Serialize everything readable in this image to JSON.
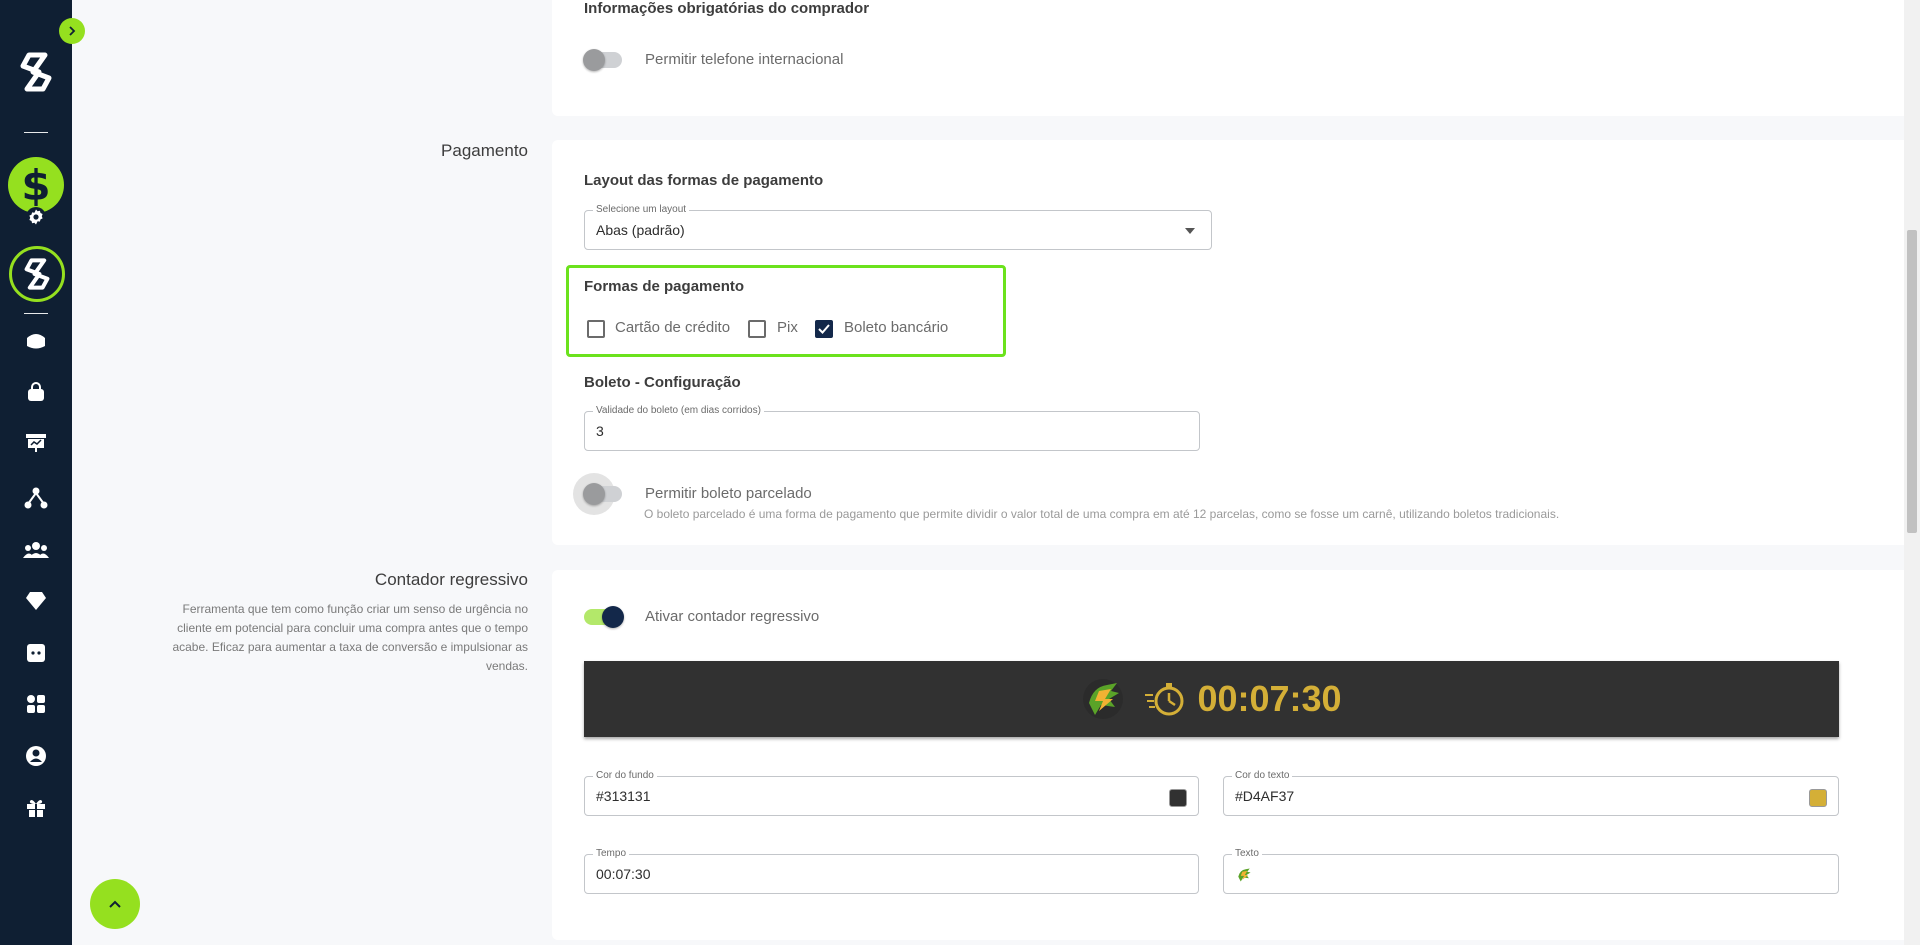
{
  "buyer_section": {
    "heading": "Informações obrigatórias do comprador",
    "intl_phone_label": "Permitir telefone internacional"
  },
  "payment_section": {
    "title": "Pagamento",
    "layout_heading": "Layout das formas de pagamento",
    "layout_select_legend": "Selecione um layout",
    "layout_select_value": "Abas (padrão)",
    "methods_heading": "Formas de pagamento",
    "methods": [
      {
        "label": "Cartão de crédito",
        "checked": false
      },
      {
        "label": "Pix",
        "checked": false
      },
      {
        "label": "Boleto bancário",
        "checked": true
      }
    ],
    "boleto_heading": "Boleto - Configuração",
    "boleto_validity_legend": "Validade do boleto (em dias corridos)",
    "boleto_validity_value": "3",
    "installments_label": "Permitir boleto parcelado",
    "installments_help": "O boleto parcelado é uma forma de pagamento que permite dividir o valor total de uma compra em até 12 parcelas, como se fosse um carnê, utilizando boletos tradicionais."
  },
  "countdown_section": {
    "title": "Contador regressivo",
    "description": "Ferramenta que tem como função criar um senso de urgência no cliente em potencial para concluir uma compra antes que o tempo acabe. Eficaz para aumentar a taxa de conversão e impulsionar as vendas.",
    "enable_label": "Ativar contador regressivo",
    "preview_time": "00:07:30",
    "bg_color_legend": "Cor do fundo",
    "bg_color_value": "#313131",
    "text_color_legend": "Cor do texto",
    "text_color_value": "#D4AF37",
    "time_legend": "Tempo",
    "time_value": "00:07:30",
    "text_legend": "Texto"
  },
  "colors": {
    "accent": "#95e01f",
    "sidebar_bg": "#0f1f33",
    "highlight": "#6be21c",
    "timer_bg": "#313131",
    "timer_text": "#D4AF37"
  },
  "icons": {
    "sidebar": [
      "logo-icon",
      "dollar-icon",
      "gear-icon",
      "ring-logo-icon",
      "home-icon",
      "bag-icon",
      "monitor-icon",
      "network-icon",
      "users-icon",
      "diamond-icon",
      "puzzle-icon",
      "apps-icon",
      "account-icon",
      "gift-icon"
    ]
  }
}
